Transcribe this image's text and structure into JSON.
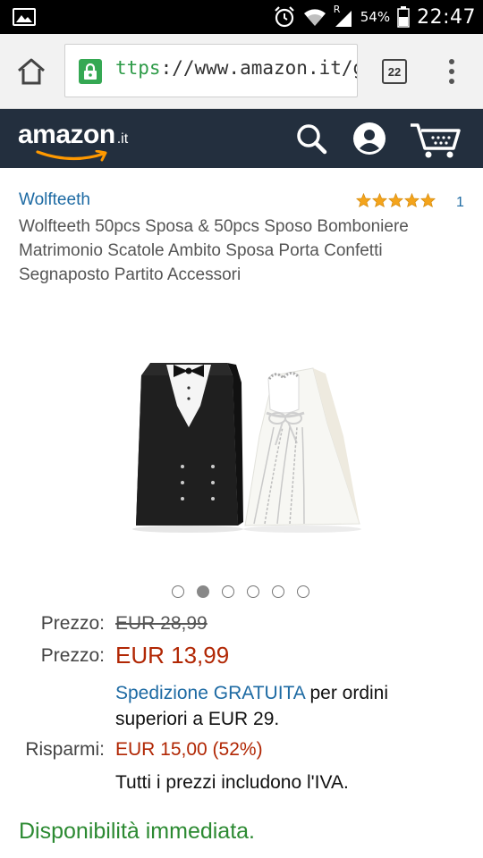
{
  "status_bar": {
    "battery_percent": "54%",
    "time": "22:47",
    "icons": [
      "gallery-icon",
      "alarm-icon",
      "wifi-icon",
      "roaming-indicator",
      "signal-icon",
      "battery-icon"
    ],
    "roaming_letter": "R"
  },
  "browser": {
    "url_protocol": "ttps",
    "url_rest": "://www.amazon.it/g",
    "tab_count": "22",
    "icons": [
      "home-icon",
      "lock-icon",
      "overflow-menu-icon"
    ]
  },
  "header": {
    "logo_word": "amazon",
    "logo_tld": ".it",
    "icons": [
      "search-icon",
      "account-icon",
      "cart-icon"
    ],
    "background_color": "#232f3e"
  },
  "product": {
    "brand": "Wolfteeth",
    "rating_stars": 5,
    "rating_count": "1",
    "title": "Wolfteeth 50pcs Sposa & 50pcs Sposo Bomboniere Matrimonio Scatole Ambito Sposa Porta Confetti Segnaposto Partito Accessori",
    "image_count": 6,
    "active_image_index": 1
  },
  "pricing": {
    "list_price_label": "Prezzo:",
    "list_price": "EUR 28,99",
    "sale_price_label": "Prezzo:",
    "sale_price": "EUR 13,99",
    "shipping_prefix": "Spedizione GRATUITA",
    "shipping_suffix": " per ordini superiori a EUR 29.",
    "savings_label": "Risparmi:",
    "savings_value": "EUR 15,00 (52%)",
    "vat_note": "Tutti i prezzi includono l'IVA.",
    "price_color": "#b12704",
    "link_color": "#1d6aa3"
  },
  "availability": {
    "text": "Disponibilità immediata.",
    "color": "#2c8a32"
  }
}
